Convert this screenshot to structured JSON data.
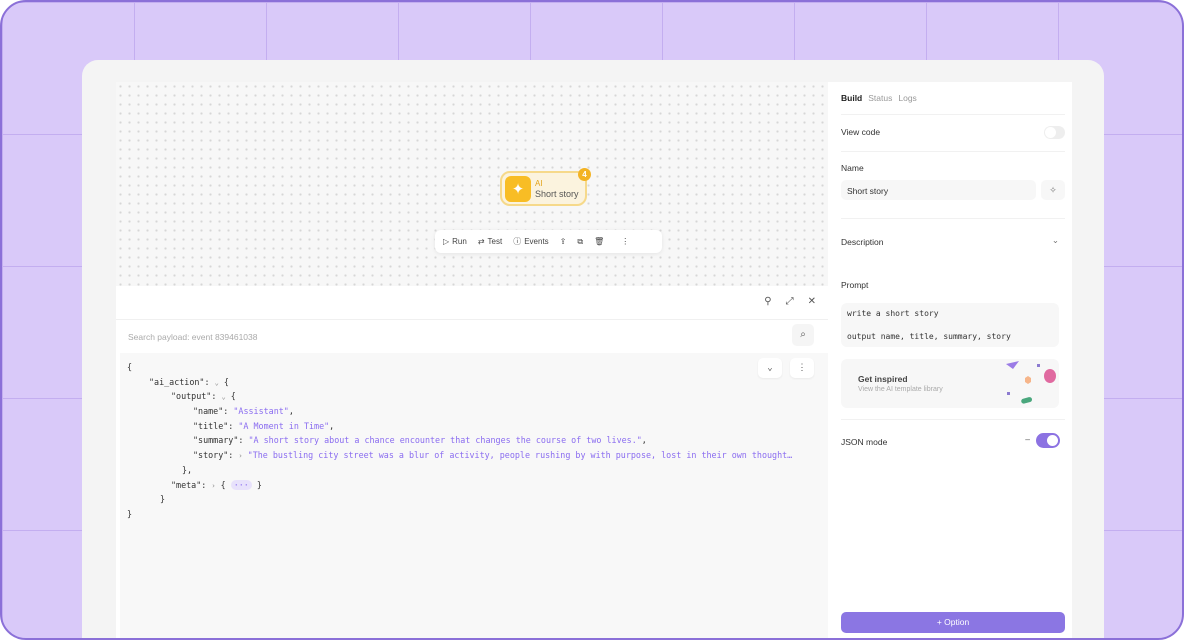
{
  "canvas": {
    "node": {
      "type": "AI",
      "name": "Short story",
      "badge": "4"
    },
    "toolbar": {
      "run": "Run",
      "test": "Test",
      "events": "Events"
    }
  },
  "payload": {
    "search_placeholder": "Search payload: event 839461038",
    "json": {
      "ai_action_key": "\"ai_action\"",
      "output_key": "\"output\"",
      "name_key": "\"name\"",
      "name_val": "\"Assistant\"",
      "title_key": "\"title\"",
      "title_val": "\"A Moment in Time\"",
      "summary_key": "\"summary\"",
      "summary_val": "\"A short story about a chance encounter that changes the course of two lives.\"",
      "story_key": "\"story\"",
      "story_val": "\"The bustling city street was a blur of activity, people rushing by with purpose, lost in their own thought…",
      "meta_key": "\"meta\"",
      "ellipsis": "···"
    }
  },
  "panel": {
    "tabs": [
      "Build",
      "Status",
      "Logs"
    ],
    "view_code": "View code",
    "name_label": "Name",
    "name_value": "Short story",
    "description_label": "Description",
    "prompt_label": "Prompt",
    "prompt_lines": [
      "write a short story",
      "output name, title, summary, story"
    ],
    "inspired_title": "Get inspired",
    "inspired_sub": "View the AI template library",
    "json_mode": "JSON mode",
    "json_mode_on": true,
    "option_button": "+ Option"
  }
}
